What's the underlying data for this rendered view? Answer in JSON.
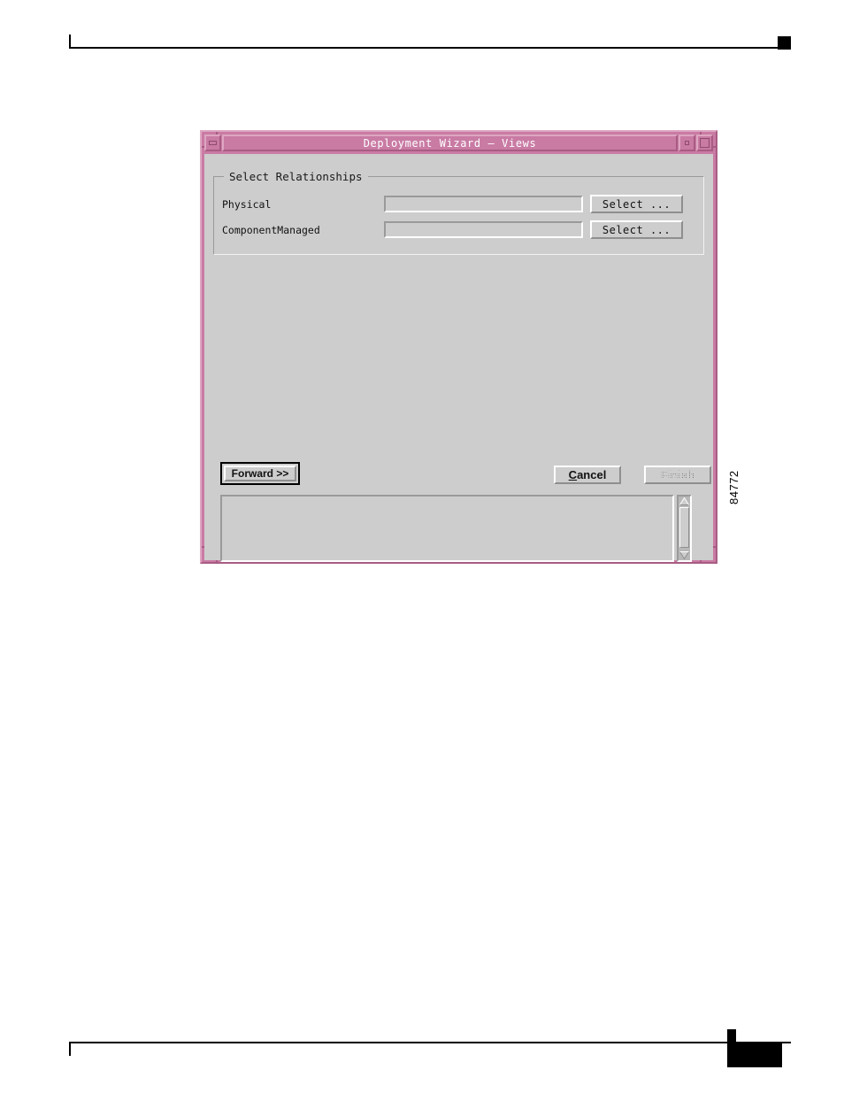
{
  "page": {
    "background": "#ffffff",
    "figure_id": "84772"
  },
  "window": {
    "title": "Deployment Wizard — Views",
    "frame_color": "#c97ba4",
    "client_color": "#cdcdcd",
    "controls": {
      "minimize": "minimize-button",
      "restore": "restore-button",
      "maximize": "maximize-button"
    }
  },
  "group": {
    "legend": "Select Relationships",
    "rows": [
      {
        "label": "Physical",
        "value": "",
        "placeholder": "",
        "button": "Select ..."
      },
      {
        "label": "ComponentManaged",
        "value": "",
        "placeholder": "",
        "button": "Select ..."
      }
    ]
  },
  "actions": {
    "forward": "Forward >>",
    "cancel_prefix": "C",
    "cancel_rest": "ancel",
    "cancel_full": "Cancel",
    "finish": "Finish",
    "finish_enabled": false,
    "forward_is_default": true
  },
  "console": {
    "value": "",
    "placeholder": ""
  },
  "scrollbar": {
    "up_arrow": "scroll-up-arrow",
    "down_arrow": "scroll-down-arrow",
    "thumb_position": "top"
  }
}
